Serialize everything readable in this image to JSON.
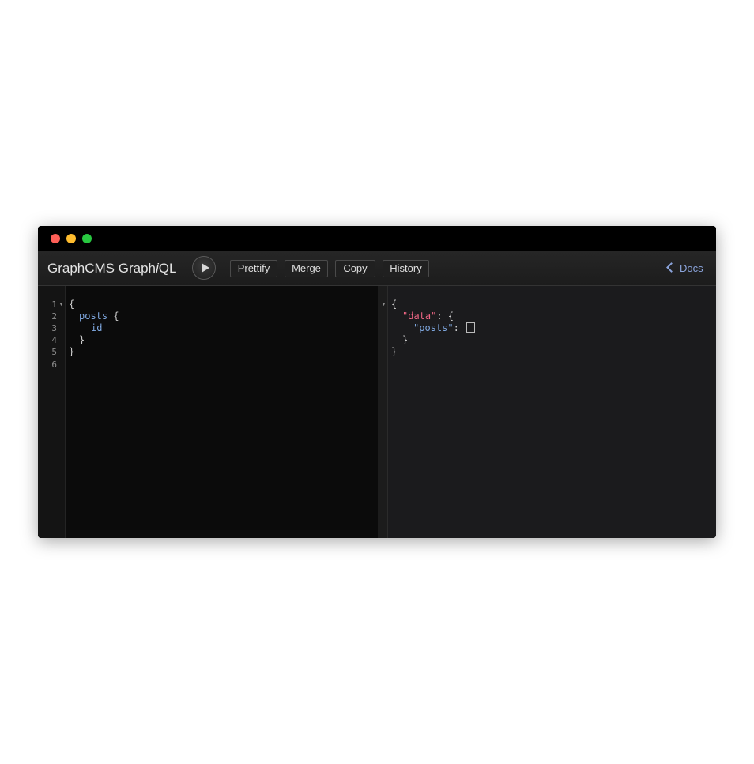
{
  "window": {
    "traffic_lights": [
      "close",
      "minimize",
      "maximize"
    ]
  },
  "toolbar": {
    "title_prefix": "GraphCMS Graph",
    "title_italic": "i",
    "title_suffix": "QL",
    "buttons": {
      "prettify": "Prettify",
      "merge": "Merge",
      "copy": "Copy",
      "history": "History"
    },
    "docs": "Docs"
  },
  "editor": {
    "line_numbers": [
      "1",
      "2",
      "3",
      "4",
      "5",
      "6"
    ],
    "lines": {
      "l1": "{",
      "l2_field": "posts",
      "l2_brace": " {",
      "l3_field": "id",
      "l4": "}",
      "l5": "}"
    }
  },
  "result": {
    "l1": "{",
    "data_key": "\"data\"",
    "data_rest": ": {",
    "posts_key": "\"posts\"",
    "posts_colon": ": ",
    "l4": "}",
    "l5": "}"
  },
  "colors": {
    "accent_link": "#8ba4dc",
    "json_key_data": "#f06785",
    "field_blue": "#7fa8e0"
  }
}
